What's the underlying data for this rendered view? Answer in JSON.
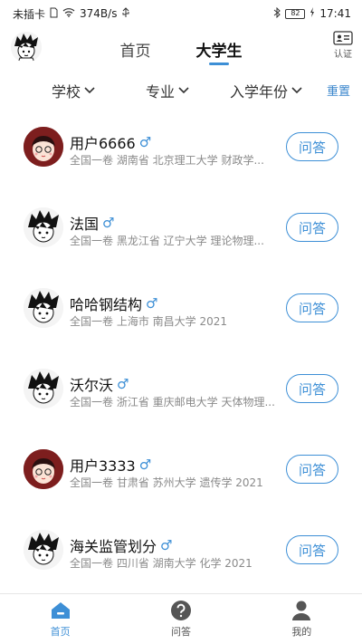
{
  "status": {
    "carrier": "未插卡",
    "speed": "374B/s",
    "battery": "82",
    "time": "17:41"
  },
  "header": {
    "tabs": [
      {
        "label": "首页",
        "active": false
      },
      {
        "label": "大学生",
        "active": true
      }
    ],
    "cert_label": "认证"
  },
  "filters": {
    "school": "学校",
    "major": "专业",
    "year": "入学年份",
    "reset": "重置"
  },
  "users": [
    {
      "name": "用户6666",
      "gender": "♂",
      "meta": "全国一卷 湖南省 北京理工大学 财政学...",
      "ask": "问答",
      "avatar": "red"
    },
    {
      "name": "法国",
      "gender": "♂",
      "meta": "全国一卷 黑龙江省 辽宁大学 理论物理...",
      "ask": "问答",
      "avatar": "sketch"
    },
    {
      "name": "哈哈钢结构",
      "gender": "♂",
      "meta": "全国一卷 上海市 南昌大学 2021",
      "ask": "问答",
      "avatar": "sketch"
    },
    {
      "name": "沃尔沃",
      "gender": "♂",
      "meta": "全国一卷 浙江省 重庆邮电大学 天体物理...",
      "ask": "问答",
      "avatar": "sketch"
    },
    {
      "name": "用户3333",
      "gender": "♂",
      "meta": "全国一卷 甘肃省 苏州大学 遗传学 2021",
      "ask": "问答",
      "avatar": "red"
    },
    {
      "name": "海关监管划分",
      "gender": "♂",
      "meta": "全国一卷 四川省 湖南大学 化学 2021",
      "ask": "问答",
      "avatar": "sketch"
    }
  ],
  "bottom_nav": [
    {
      "label": "首页",
      "icon": "home-icon",
      "active": true
    },
    {
      "label": "问答",
      "icon": "question-icon",
      "active": false
    },
    {
      "label": "我的",
      "icon": "person-icon",
      "active": false
    }
  ],
  "colors": {
    "accent": "#3d8fd6"
  }
}
